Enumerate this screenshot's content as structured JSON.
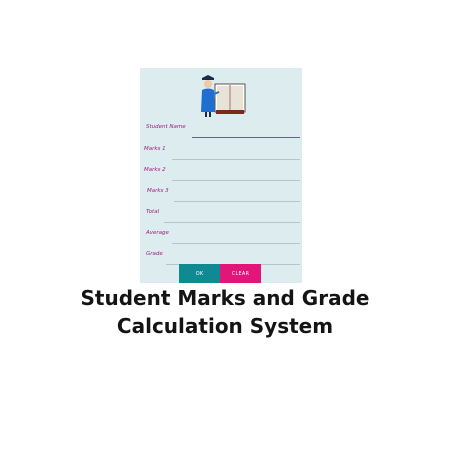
{
  "form": {
    "fields": [
      {
        "label": "Student Name"
      },
      {
        "label": "Marks 1"
      },
      {
        "label": "Marks 2"
      },
      {
        "label": "Marks 3"
      },
      {
        "label": "Total"
      },
      {
        "label": "Average"
      },
      {
        "label": "Grade"
      }
    ],
    "ok_label": "OK",
    "clear_label": "CLEAR"
  },
  "caption": {
    "line1": "Student Marks and Grade",
    "line2": "Calculation System"
  },
  "colors": {
    "app_background": "#dcecef",
    "label_color": "#9b1f7a",
    "ok_button": "#0f8a93",
    "clear_button": "#e2157a"
  },
  "icons": {
    "logo": "graduate-with-book-icon"
  }
}
